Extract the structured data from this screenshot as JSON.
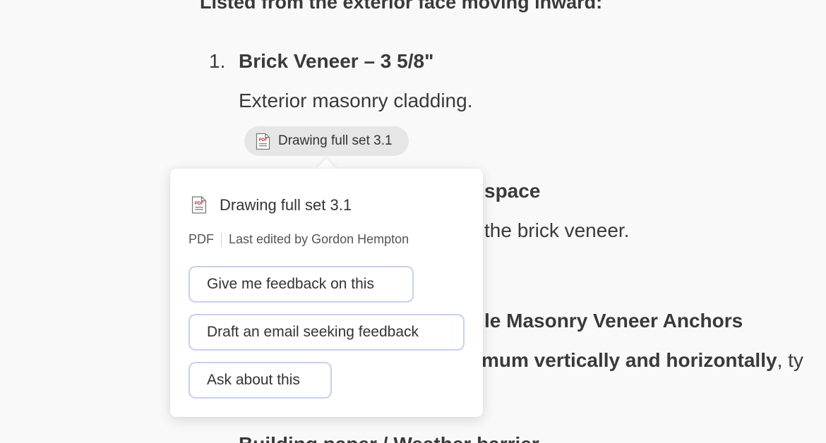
{
  "document": {
    "intro_text": "Listed from the exterior face moving inward:",
    "items": [
      {
        "number": "1.",
        "title": "Brick Veneer – 3 5/8\"",
        "description": "Exterior masonry cladding."
      },
      {
        "title_visible": "space",
        "description_visible": "the brick veneer."
      },
      {
        "title_visible": "le Masonry Veneer Anchors",
        "description_bold_visible": "mum vertically and horizontally",
        "description_rest_visible": ", ty"
      }
    ],
    "partial_bottom_text": "Building paper / Weather barrier"
  },
  "attachment_chip": {
    "icon": "pdf-file-icon",
    "label": "Drawing full set 3.1"
  },
  "popover": {
    "file_icon": "pdf-file-icon",
    "title": "Drawing full set 3.1",
    "file_type": "PDF",
    "last_edited": "Last edited by Gordon Hempton",
    "actions": [
      {
        "label": "Give me feedback on this"
      },
      {
        "label": "Draft an email seeking feedback"
      },
      {
        "label": "Ask about this"
      }
    ]
  },
  "colors": {
    "background": "#f9f9f9",
    "chip_background": "#e6e6e6",
    "button_border": "#c9d1ec",
    "pdf_red": "#c0262d"
  }
}
